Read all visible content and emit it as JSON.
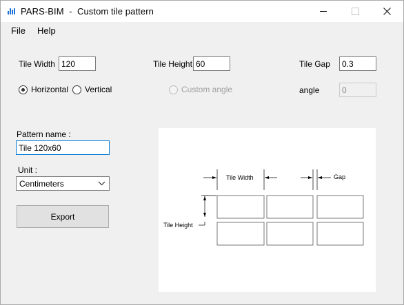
{
  "window": {
    "title": "PARS-BIM  -  Custom tile pattern"
  },
  "menu": {
    "file": "File",
    "help": "Help"
  },
  "fields": {
    "tile_width_label": "Tile Width",
    "tile_width_value": "120",
    "tile_height_label": "Tile Height",
    "tile_height_value": "60",
    "tile_gap_label": "Tile Gap",
    "tile_gap_value": "0.3",
    "angle_label": "angle",
    "angle_value": "0"
  },
  "orientation": {
    "horizontal": "Horizontal",
    "vertical": "Vertical",
    "custom_angle": "Custom angle",
    "selected": "Horizontal"
  },
  "pattern": {
    "name_label": "Pattern name :",
    "name_value": "Tile 120x60"
  },
  "unit": {
    "label": "Unit :",
    "selected": "Centimeters"
  },
  "export_button": "Export",
  "preview": {
    "tile_width_label": "Tile Width",
    "gap_label": "Gap",
    "tile_height_label": "Tile Height",
    "rows": 2,
    "columns": 3
  }
}
